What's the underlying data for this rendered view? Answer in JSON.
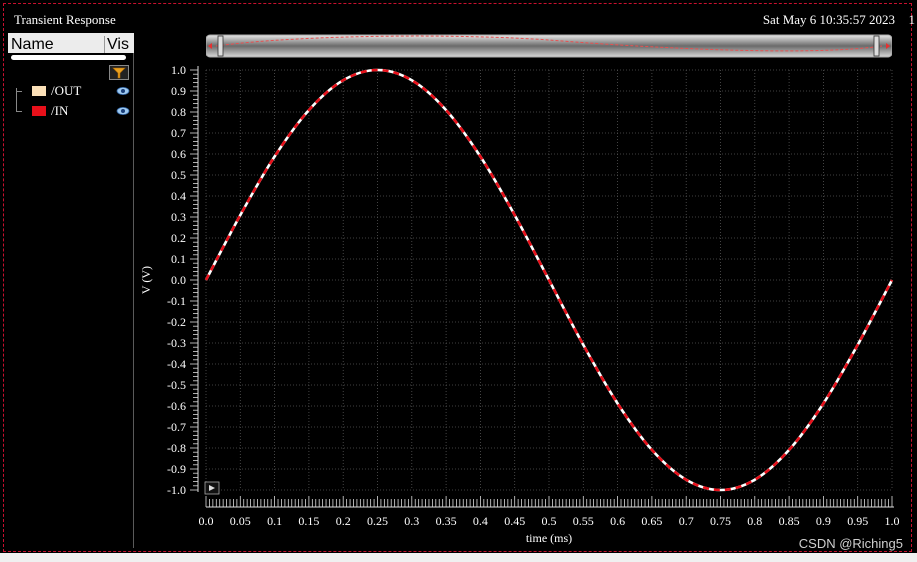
{
  "window": {
    "title": "Transient Response",
    "datetime": "Sat May 6 10:35:57 2023",
    "datetime_extra": "1"
  },
  "legend": {
    "header_name": "Name",
    "header_vis": "Vis",
    "items": [
      {
        "label": "/OUT",
        "color": "#fbe0b8"
      },
      {
        "label": "/IN",
        "color": "#e8101a"
      }
    ]
  },
  "colors": {
    "background": "#000000",
    "grid": "#555555",
    "trace_out": "#ffffff",
    "trace_in": "#e8101a",
    "border": "#c8102e"
  },
  "watermark": "CSDN @Riching5",
  "chart_data": {
    "type": "line",
    "title": "",
    "xlabel": "time (ms)",
    "ylabel": "V (V)",
    "xlim": [
      0.0,
      1.0
    ],
    "ylim": [
      -1.0,
      1.0
    ],
    "grid": true,
    "x_ticks": [
      "0.0",
      "0.05",
      "0.1",
      "0.15",
      "0.2",
      "0.25",
      "0.3",
      "0.35",
      "0.4",
      "0.45",
      "0.5",
      "0.55",
      "0.6",
      "0.65",
      "0.7",
      "0.75",
      "0.8",
      "0.85",
      "0.9",
      "0.95",
      "1.0"
    ],
    "y_ticks": [
      "1.0",
      "0.9",
      "0.8",
      "0.7",
      "0.6",
      "0.5",
      "0.4",
      "0.3",
      "0.2",
      "0.1",
      "0.0",
      "-0.1",
      "-0.2",
      "-0.3",
      "-0.4",
      "-0.5",
      "-0.6",
      "-0.7",
      "-0.8",
      "-0.9",
      "-1.0"
    ],
    "x": [
      0.0,
      0.05,
      0.1,
      0.15,
      0.2,
      0.25,
      0.3,
      0.35,
      0.4,
      0.45,
      0.5,
      0.55,
      0.6,
      0.65,
      0.7,
      0.75,
      0.8,
      0.85,
      0.9,
      0.95,
      1.0
    ],
    "series": [
      {
        "name": "/OUT",
        "values": [
          0.0,
          0.309,
          0.588,
          0.809,
          0.951,
          1.0,
          0.951,
          0.809,
          0.588,
          0.309,
          0.0,
          -0.309,
          -0.588,
          -0.809,
          -0.951,
          -1.0,
          -0.951,
          -0.809,
          -0.588,
          -0.309,
          0.0
        ]
      },
      {
        "name": "/IN",
        "values": [
          0.0,
          0.309,
          0.588,
          0.809,
          0.951,
          1.0,
          0.951,
          0.809,
          0.588,
          0.309,
          0.0,
          -0.309,
          -0.588,
          -0.809,
          -0.951,
          -1.0,
          -0.951,
          -0.809,
          -0.588,
          -0.309,
          0.0
        ]
      }
    ]
  }
}
